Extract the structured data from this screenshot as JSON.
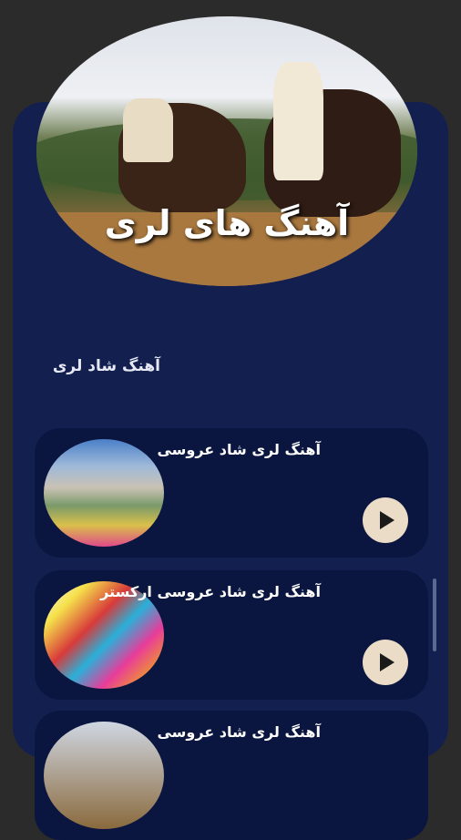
{
  "hero": {
    "title": "آهنگ های لری"
  },
  "section": {
    "title": "آهنگ شاد لری"
  },
  "songs": [
    {
      "title": "آهنگ لری شاد عروسی",
      "play_icon": "play-icon"
    },
    {
      "title": "آهنگ لری شاد عروسی ارکستر",
      "play_icon": "play-icon"
    },
    {
      "title": "آهنگ لری شاد عروسی",
      "play_icon": "play-icon"
    }
  ],
  "colors": {
    "background": "#2b2b2b",
    "panel": "#13204f",
    "card": "#0b1640",
    "play_button": "#eadcc6"
  }
}
